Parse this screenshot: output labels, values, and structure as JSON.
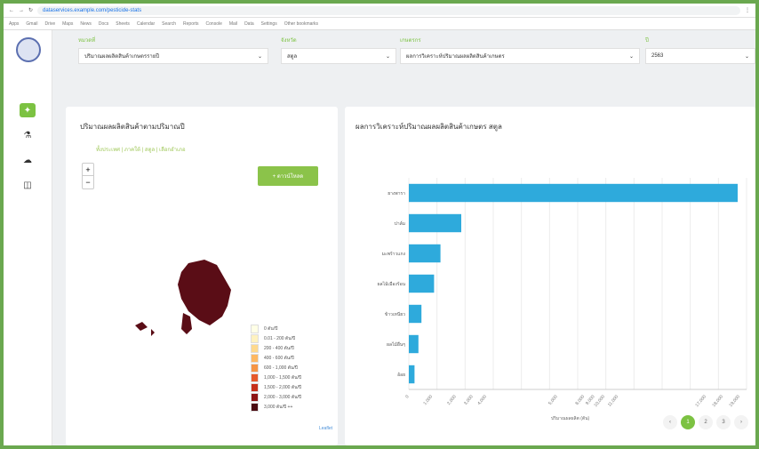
{
  "browser": {
    "url": "dataservices.example.com/pesticide-stats",
    "bookmarks": [
      "Apps",
      "Gmail",
      "Drive",
      "Maps",
      "News",
      "Docs",
      "Sheets",
      "Calendar",
      "Search",
      "Reports",
      "Console",
      "Mail",
      "Data",
      "Settings",
      "Other bookmarks"
    ]
  },
  "sidebar": {
    "items": [
      {
        "icon": "chart-icon",
        "glyph": "✦",
        "active": true
      },
      {
        "icon": "filter-icon",
        "glyph": "⚗",
        "active": false
      },
      {
        "icon": "cloud-icon",
        "glyph": "☁",
        "active": false
      },
      {
        "icon": "document-icon",
        "glyph": "◫",
        "active": false
      }
    ]
  },
  "filters": {
    "category": {
      "label": "หมวดที่",
      "value": "ปริมาณผลผลิตสินค้าเกษตรรายปี"
    },
    "province": {
      "label": "จังหวัด",
      "value": "สตูล"
    },
    "commodity": {
      "label": "เกษตรกร",
      "value": "ผลการวิเคราะห์ปริมาณผลผลิตสินค้าเกษตร"
    },
    "year": {
      "label": "ปี",
      "value": "2563"
    }
  },
  "map_card": {
    "title": "ปริมาณผลผลิตสินค้าตามปริมาณปี",
    "links": "ทั้งประเทศ  |  ภาคใต้  |  สตูล  |  เลือกอำเภอ",
    "zoom_in": "+",
    "zoom_out": "−",
    "download_label": "+ ดาวน์โหลด",
    "legend": [
      {
        "label": "0 ตัน/ปี",
        "color": "#ffffe6"
      },
      {
        "label": "0.01 - 200 ตัน/ปี",
        "color": "#fff2c0"
      },
      {
        "label": "200 - 400 ตัน/ปี",
        "color": "#fed98e"
      },
      {
        "label": "400 - 600 ตัน/ปี",
        "color": "#fdb863"
      },
      {
        "label": "600 - 1,000 ตัน/ปี",
        "color": "#f59545"
      },
      {
        "label": "1,000 - 1,500 ตัน/ปี",
        "color": "#e65a2c"
      },
      {
        "label": "1,500 - 2,000 ตัน/ปี",
        "color": "#c6301a"
      },
      {
        "label": "2,000 - 3,000 ตัน/ปี",
        "color": "#8d1414"
      },
      {
        "label": "3,000 ตัน/ปี ++",
        "color": "#4a0a10"
      }
    ],
    "credit": "Leaflet",
    "region_color": "#5a0d16"
  },
  "bar_card": {
    "title": "ผลการวิเคราะห์ปริมาณผลผลิตสินค้าเกษตร สตูล",
    "xlabel": "ปริมาณผลผลิต (ตัน)",
    "pages": [
      "‹",
      "1",
      "2",
      "3",
      "›"
    ],
    "current_page": "1"
  },
  "chart_data": {
    "type": "bar",
    "orientation": "horizontal",
    "categories": [
      "ยางพารา",
      "ปาล์ม",
      "มะพร้าวแกง",
      "ผลไม้เมืองร้อน",
      "ข้าวเหนียว",
      "ผลไม้อื่นๆ",
      "อ้อย"
    ],
    "values": [
      18500,
      2950,
      1780,
      1420,
      710,
      540,
      320
    ],
    "xticks": [
      "0",
      "1,000",
      "2,000",
      "3,000",
      "4,000",
      "5,000",
      "8,000",
      "9,000",
      "10,000",
      "11,000",
      "17,000",
      "18,000",
      "19,000"
    ],
    "xlim": [
      0,
      19000
    ],
    "bar_color": "#2eaadc",
    "grid": true
  }
}
